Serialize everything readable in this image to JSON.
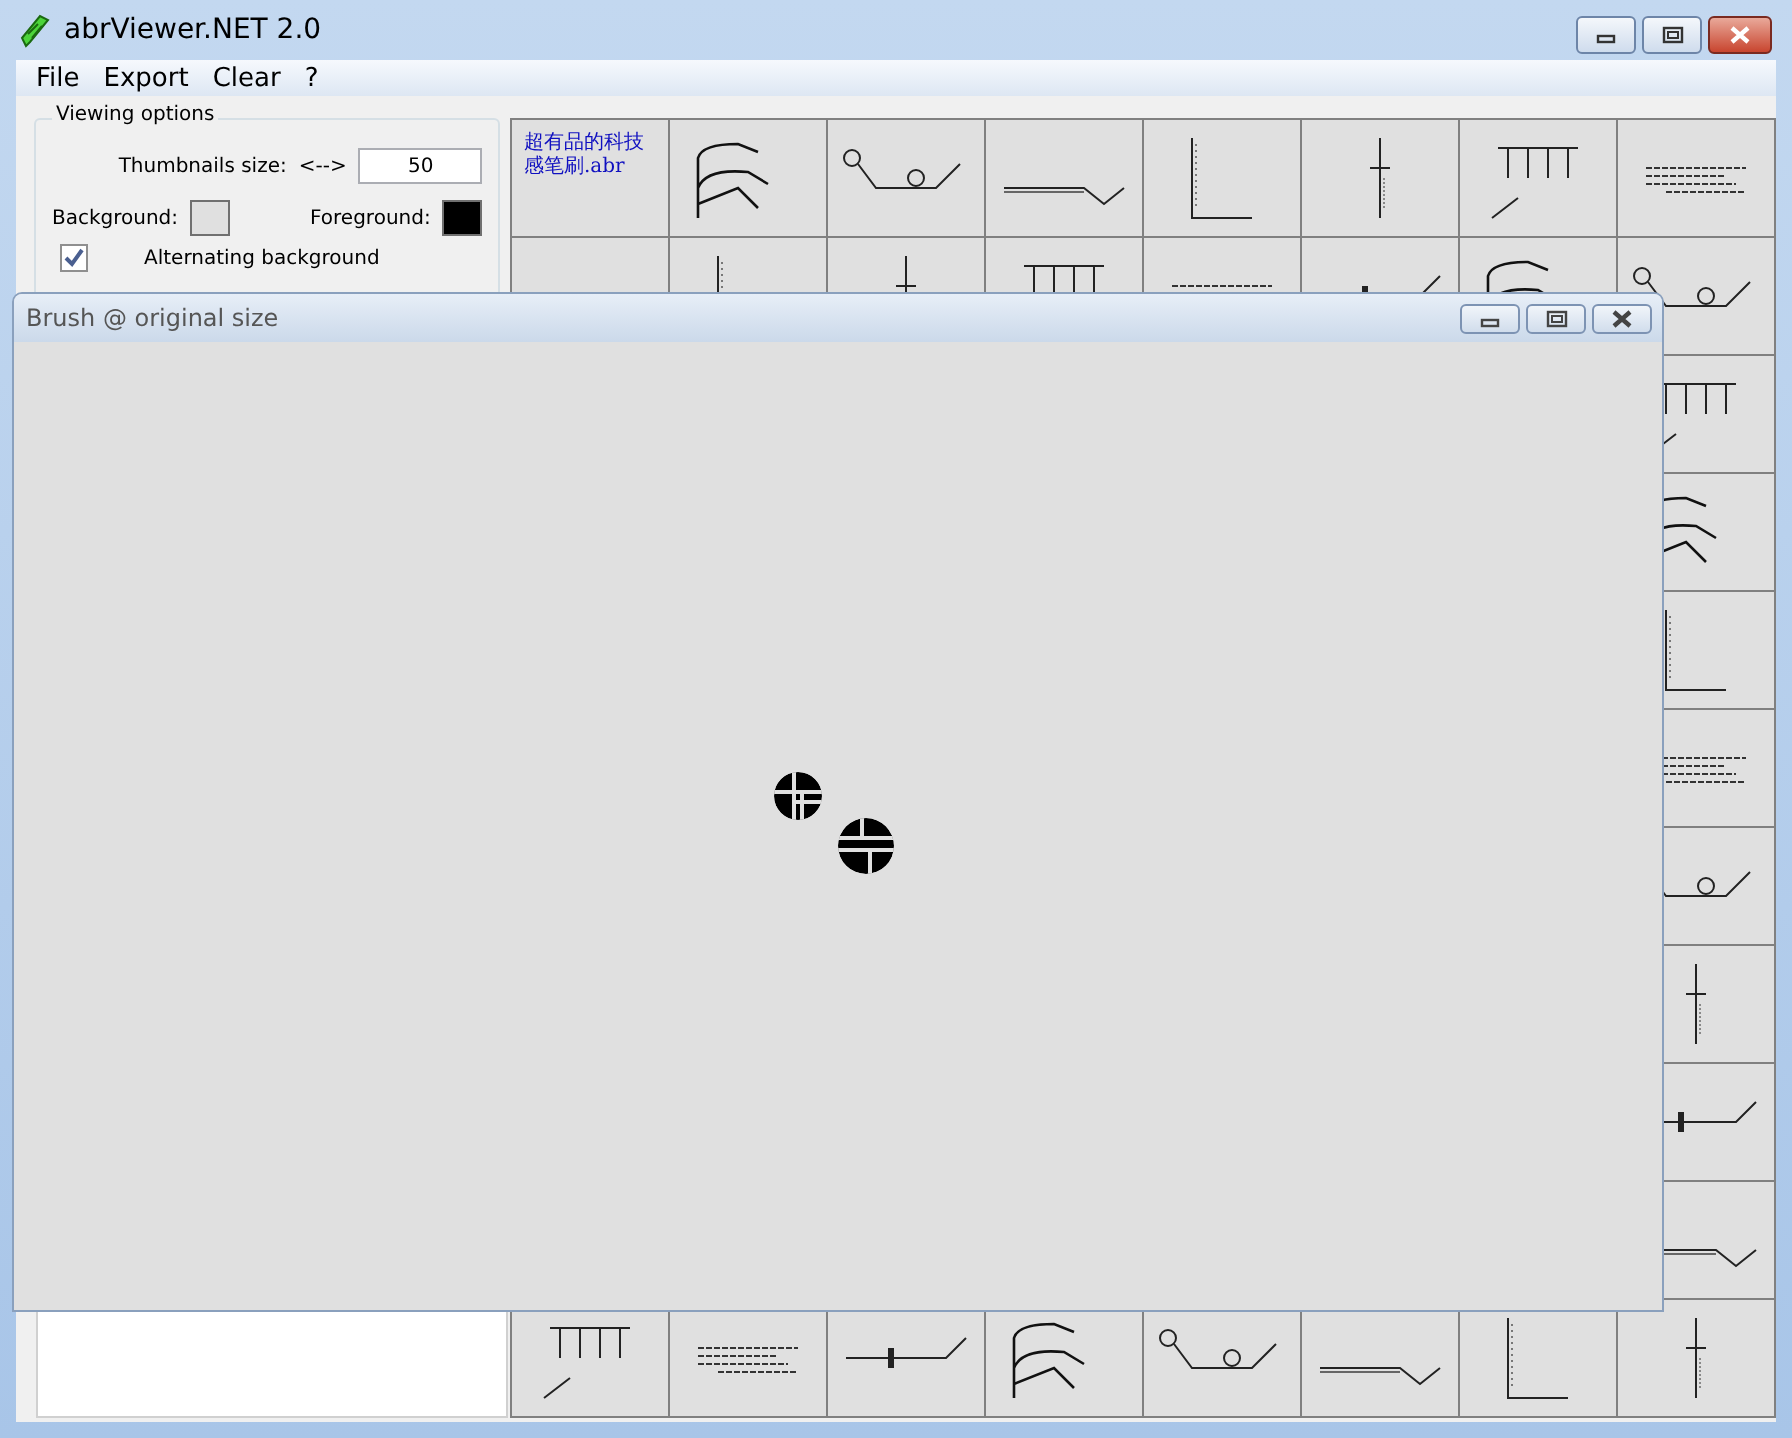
{
  "window": {
    "title": "abrViewer.NET 2.0"
  },
  "menu": [
    "File",
    "Export",
    "Clear",
    "?"
  ],
  "viewing_options": {
    "title": "Viewing options",
    "thumbnail_size_label": "Thumbnails size:",
    "resize_symbol": "<-->",
    "thumbnail_size": "50",
    "swatches": [
      {
        "label": "Background:",
        "color": "#e0e0e0"
      },
      {
        "label": "Foreground:",
        "color": "#000000"
      }
    ],
    "alternating_background": {
      "label": "Alternating background",
      "checked": true
    }
  },
  "thumbnail_rows": [
    {
      "cells": [
        {
          "kind": "label",
          "label": "超有品的科技感笔刷.abr"
        },
        {
          "kind": "brush"
        },
        {
          "kind": "brush"
        },
        {
          "kind": "brush"
        },
        {
          "kind": "brush"
        },
        {
          "kind": "brush"
        },
        {
          "kind": "brush"
        },
        {
          "kind": "brush"
        }
      ]
    },
    {
      "cells": [
        {
          "kind": "brush"
        },
        {
          "kind": "brush"
        },
        {
          "kind": "brush"
        },
        {
          "kind": "brush"
        },
        {
          "kind": "brush"
        },
        {
          "kind": "brush"
        },
        {
          "kind": "brush"
        },
        {
          "kind": "brush"
        }
      ]
    },
    {
      "cells": [
        {
          "kind": "brush"
        }
      ]
    },
    {
      "cells": [
        {
          "kind": "brush"
        }
      ]
    },
    {
      "cells": [
        {
          "kind": "brush"
        }
      ]
    },
    {
      "cells": [
        {
          "kind": "brush"
        }
      ]
    },
    {
      "cells": [
        {
          "kind": "brush"
        }
      ]
    },
    {
      "cells": [
        {
          "kind": "brush"
        }
      ]
    },
    {
      "cells": [
        {
          "kind": "brush"
        }
      ]
    },
    {
      "cells": [
        {
          "kind": "brush"
        }
      ]
    },
    {
      "cells": [
        {
          "kind": "brush"
        },
        {
          "kind": "brush"
        },
        {
          "kind": "brush"
        },
        {
          "kind": "brush"
        },
        {
          "kind": "brush"
        },
        {
          "kind": "brush"
        },
        {
          "kind": "brush"
        },
        {
          "kind": "brush"
        }
      ]
    }
  ],
  "brush_window": {
    "title": "Brush @ original size"
  }
}
